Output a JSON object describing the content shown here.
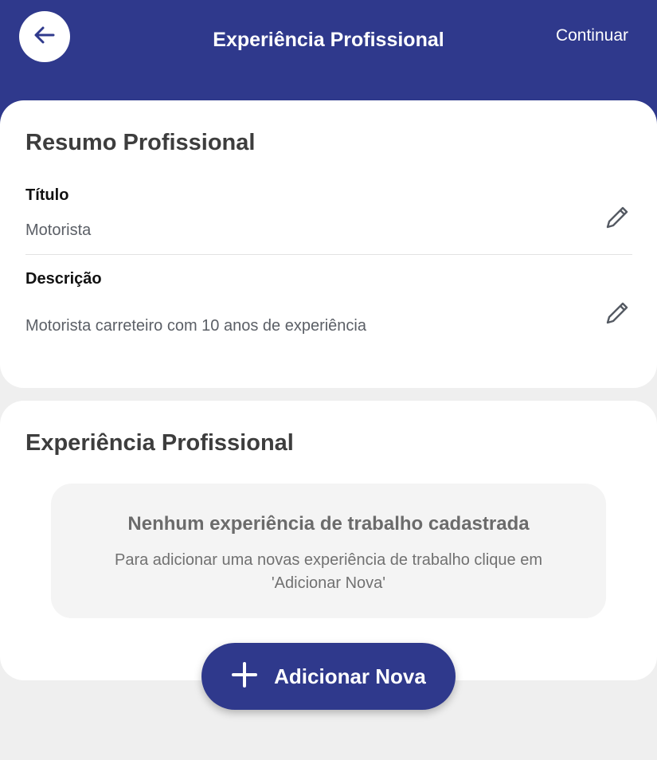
{
  "header": {
    "title": "Experiência Profissional",
    "continue_label": "Continuar",
    "back_icon": "arrow-left-icon"
  },
  "summary": {
    "title": "Resumo Profissional",
    "fields": [
      {
        "label": "Título",
        "value": "Motorista",
        "icon": "pencil-icon"
      },
      {
        "label": "Descrição",
        "value": "Motorista carreteiro com 10 anos de experiência",
        "icon": "pencil-icon"
      }
    ]
  },
  "experience": {
    "title": "Experiência Profissional",
    "empty_title": "Nenhum experiência de trabalho cadastrada",
    "empty_description": "Para adicionar uma novas experiência de trabalho clique em 'Adicionar Nova'"
  },
  "add_button": {
    "label": "Adicionar Nova",
    "icon": "plus-icon"
  },
  "colors": {
    "primary": "#2f398c",
    "background": "#efefef",
    "card": "#ffffff",
    "empty_box": "#f4f4f4"
  }
}
